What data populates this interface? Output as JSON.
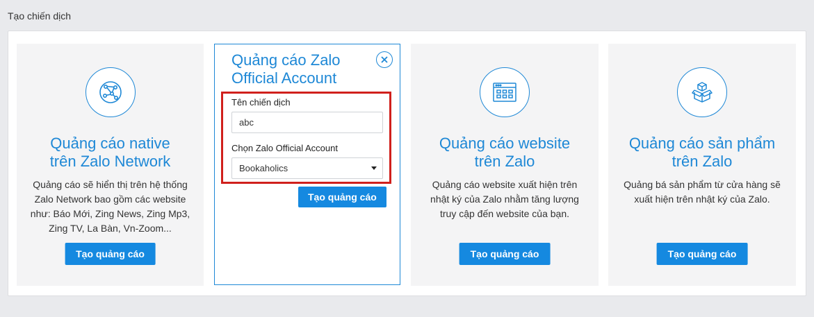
{
  "page": {
    "title": "Tạo chiến dịch"
  },
  "cards": [
    {
      "title_line1": "Quảng cáo native",
      "title_line2": "trên Zalo Network",
      "desc_lines": [
        "Quảng cáo sẽ hiển thị trên hệ thống",
        "Zalo Network bao gồm các website",
        "như: Báo Mới, Zing News, Zing Mp3,",
        "Zing TV, La Bàn, Vn-Zoom..."
      ],
      "button": "Tạo quảng cáo",
      "icon": "globe-network-icon"
    },
    {
      "title_line1": "Quảng cáo website",
      "title_line2": "trên Zalo",
      "desc_lines": [
        "Quảng cáo website xuất hiện trên",
        "nhật ký của Zalo nhằm tăng lượng",
        "truy cập đến website của bạn."
      ],
      "button": "Tạo quảng cáo",
      "icon": "browser-window-icon"
    },
    {
      "title_line1": "Quảng cáo sản phẩm",
      "title_line2": "trên Zalo",
      "desc_lines": [
        "Quảng bá sản phẩm từ cửa hàng sẽ",
        "xuất hiện trên nhật ký của Zalo."
      ],
      "button": "Tạo quảng cáo",
      "icon": "product-boxes-icon"
    }
  ],
  "active_card": {
    "title_line1": "Quảng cáo Zalo",
    "title_line2": "Official Account",
    "campaign_name_label": "Tên chiến dịch",
    "campaign_name_value": "abc",
    "account_label": "Chọn Zalo Official Account",
    "account_selected": "Bookaholics",
    "button": "Tạo quảng cáo",
    "close_icon": "close-circle-icon"
  },
  "colors": {
    "accent": "#1e88d6",
    "button": "#1589e0",
    "highlight": "#d0201c",
    "card_bg": "#f4f4f5",
    "page_bg": "#e9eaed"
  }
}
